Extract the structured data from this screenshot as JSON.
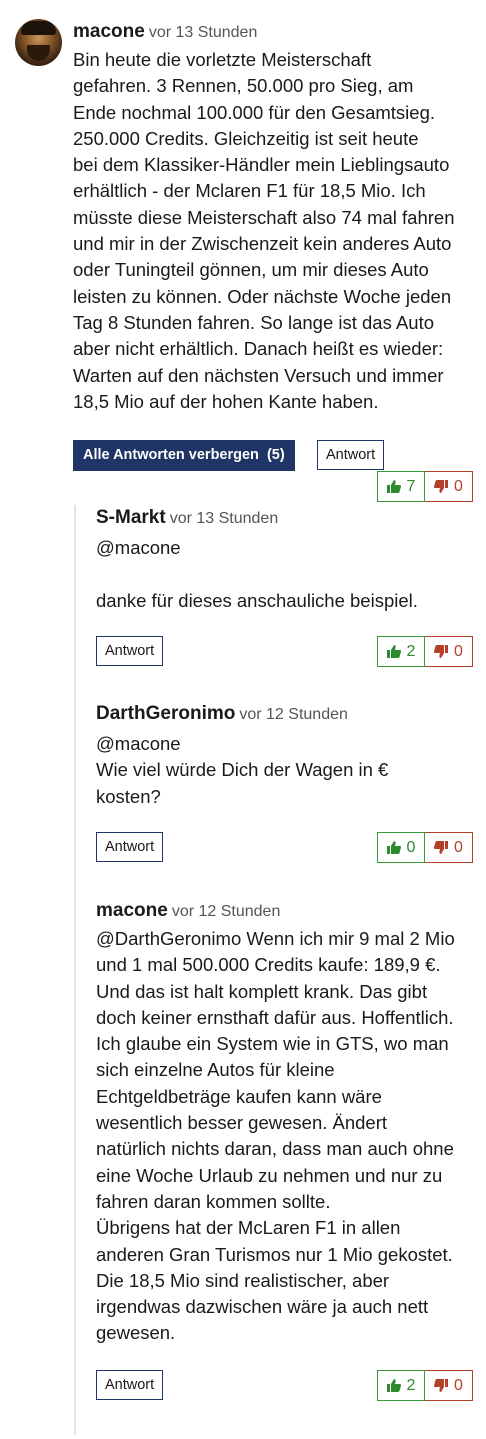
{
  "comments": [
    {
      "author": "macone",
      "time": "vor 13 Stunden",
      "lines": [
        "Bin heute die vorletzte Meisterschaft",
        "gefahren. 3 Rennen, 50.000 pro Sieg, am",
        "Ende nochmal 100.000 für den Gesamtsieg.",
        "250.000 Credits. Gleichzeitig ist seit heute",
        "bei dem Klassiker-Händler mein Lieblingsauto",
        "erhältlich - der Mclaren F1 für 18,5 Mio. Ich",
        "müsste diese Meisterschaft also 74 mal fahren",
        "und mir in der Zwischenzeit kein anderes Auto",
        "oder Tuningteil gönnen, um mir dieses Auto",
        "leisten zu können. Oder nächste Woche jeden",
        "Tag 8 Stunden fahren. So lange ist das Auto",
        "aber nicht erhältlich. Danach heißt es wieder:",
        "Warten auf den nächsten Versuch und immer",
        "18,5 Mio auf der hohen Kante haben."
      ],
      "hide_replies_label": "Alle Antworten verbergen",
      "reply_count": "(5)",
      "reply_label": "Antwort",
      "upvotes": "7",
      "downvotes": "0"
    },
    {
      "author": "S-Markt",
      "time": "vor 13 Stunden",
      "lines": [
        "@macone",
        "",
        "danke für dieses anschauliche beispiel."
      ],
      "reply_label": "Antwort",
      "upvotes": "2",
      "downvotes": "0"
    },
    {
      "author": "DarthGeronimo",
      "time": "vor 12 Stunden",
      "lines": [
        "@macone",
        "Wie viel würde Dich der Wagen in €",
        "kosten?"
      ],
      "reply_label": "Antwort",
      "upvotes": "0",
      "downvotes": "0"
    },
    {
      "author": "macone",
      "time": "vor 12 Stunden",
      "lines": [
        "@DarthGeronimo Wenn ich mir 9 mal 2 Mio",
        "und 1 mal 500.000 Credits kaufe: 189,9 €.",
        "Und das ist halt komplett krank. Das gibt",
        "doch keiner ernsthaft dafür aus. Hoffentlich.",
        "Ich glaube ein System wie in GTS, wo man",
        "sich einzelne Autos für kleine",
        "Echtgeldbeträge kaufen kann wäre",
        "wesentlich besser gewesen. Ändert",
        "natürlich nichts daran, dass man auch ohne",
        "eine Woche Urlaub zu nehmen und nur zu",
        "fahren daran kommen sollte.",
        "Übrigens hat der McLaren F1 in allen",
        "anderen Gran Turismos nur 1 Mio gekostet.",
        "Die 18,5 Mio sind realistischer, aber",
        "irgendwas dazwischen wäre ja auch nett",
        "gewesen."
      ],
      "reply_label": "Antwort",
      "upvotes": "2",
      "downvotes": "0"
    }
  ],
  "icons": {
    "thumbs_up": "thumbs-up-icon",
    "thumbs_down": "thumbs-down-icon"
  },
  "colors": {
    "button_dark": "#1f3565",
    "upvote": "#2e8a2e",
    "downvote": "#b5402a"
  }
}
